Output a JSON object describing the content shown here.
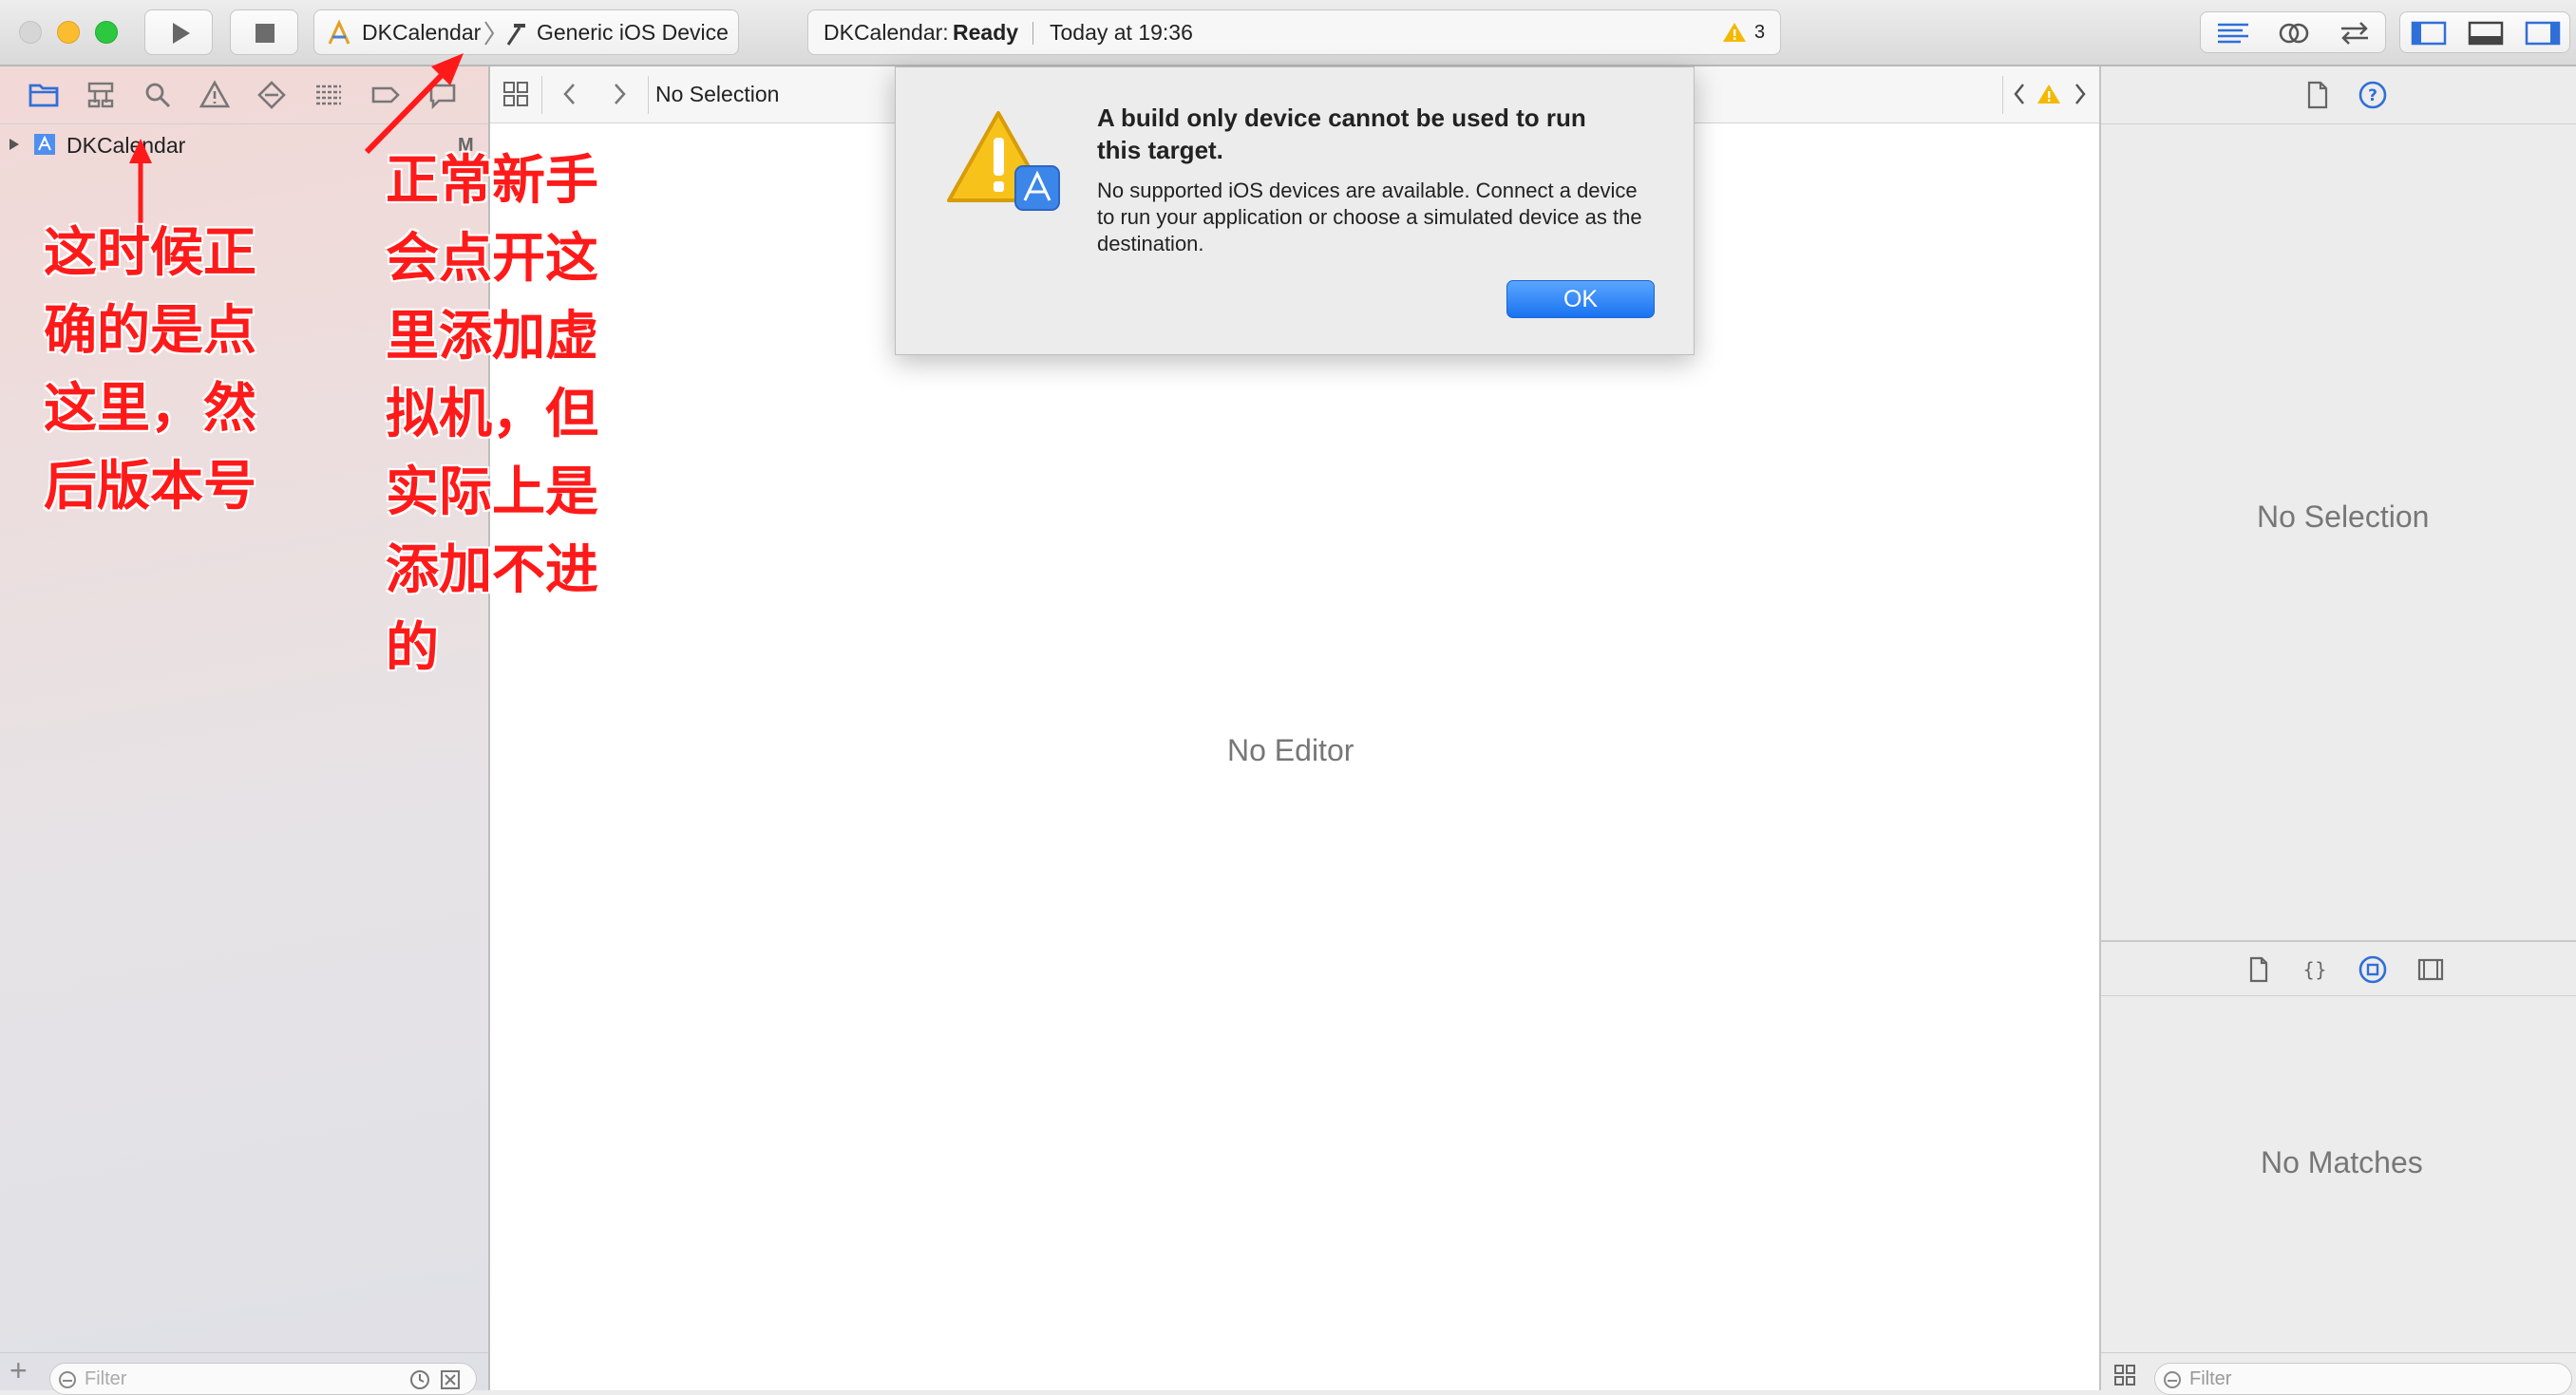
{
  "toolbar": {
    "scheme_name": "DKCalendar",
    "destination": "Generic iOS Device",
    "activity_project": "DKCalendar:",
    "activity_status": "Ready",
    "activity_time": "Today at 19:36",
    "warning_count": "3"
  },
  "navigator": {
    "project_name": "DKCalendar",
    "project_badge": "M",
    "filter_placeholder": "Filter"
  },
  "editor": {
    "jump_selection": "No Selection",
    "placeholder": "No Editor"
  },
  "inspector": {
    "top_placeholder": "No Selection",
    "bottom_placeholder": "No Matches",
    "filter_placeholder": "Filter"
  },
  "alert": {
    "title": "A build only device cannot be used to run this target.",
    "message": "No supported iOS devices are available. Connect a device to run your application or choose a simulated device as the destination.",
    "ok_label": "OK"
  },
  "annotations": {
    "left_note": "这时候正\n确的是点\n这里，然\n后版本号",
    "right_note": "正常新手\n会点开这\n里添加虚\n拟机，但\n实际上是\n添加不进\n的"
  },
  "colors": {
    "accent": "#1a72f0",
    "annotation": "#ff1a1a",
    "warning": "#f5b800"
  }
}
